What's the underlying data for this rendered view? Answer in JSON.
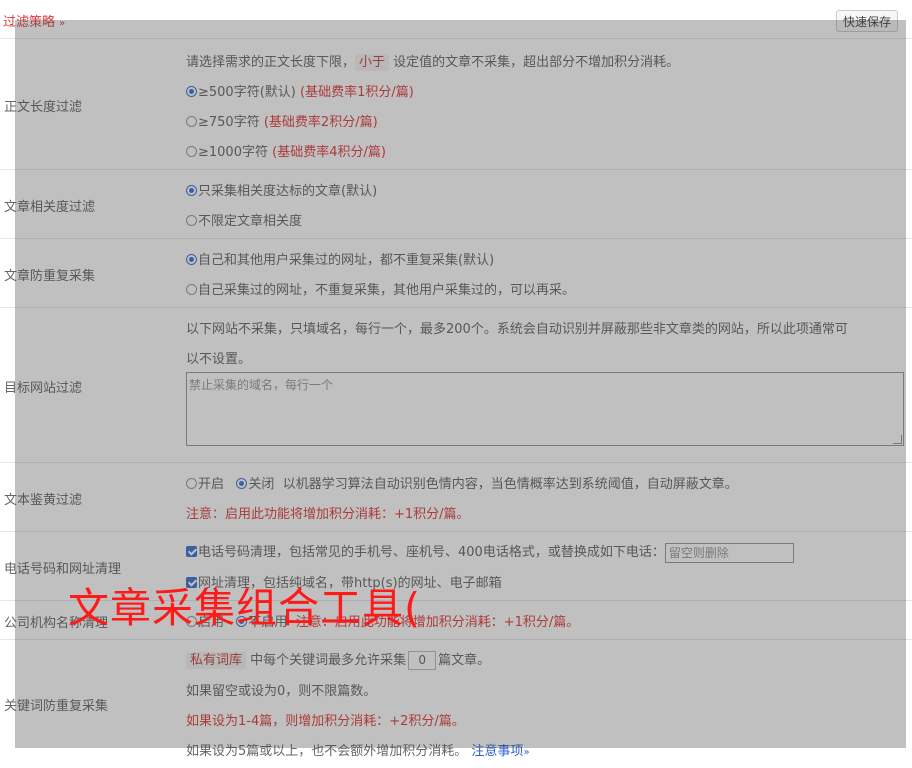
{
  "header": {
    "title": "过滤策略",
    "chevron": "»",
    "save_button": "快速保存"
  },
  "sections": {
    "length": {
      "label": "正文长度过滤",
      "intro_prefix": "请选择需求的正文长度下限，",
      "intro_tag": "小于",
      "intro_suffix": "设定值的文章不采集，超出部分不增加积分消耗。",
      "options": [
        {
          "text": "≥500字符(默认)",
          "note": "(基础费率1积分/篇)",
          "selected": true
        },
        {
          "text": "≥750字符",
          "note": "(基础费率2积分/篇)",
          "selected": false
        },
        {
          "text": "≥1000字符",
          "note": "(基础费率4积分/篇)",
          "selected": false
        }
      ]
    },
    "relevance": {
      "label": "文章相关度过滤",
      "options": [
        {
          "text": "只采集相关度达标的文章(默认)",
          "selected": true
        },
        {
          "text": "不限定文章相关度",
          "selected": false
        }
      ]
    },
    "dedupe": {
      "label": "文章防重复采集",
      "options": [
        {
          "text": "自己和其他用户采集过的网址，都不重复采集(默认)",
          "selected": true
        },
        {
          "text": "自己采集过的网址，不重复采集，其他用户采集过的，可以再采。",
          "selected": false
        }
      ]
    },
    "sites": {
      "label": "目标网站过滤",
      "intro_line1": "以下网站不采集，只填域名，每行一个，最多200个。系统会自动识别并屏蔽那些非文章类的网站，所以此项通常可",
      "intro_line2": "以不设置。",
      "placeholder": "禁止采集的域名，每行一个"
    },
    "porn": {
      "label": "文本鉴黄过滤",
      "option_on": "开启",
      "option_off": "关闭",
      "description": "以机器学习算法自动识别色情内容，当色情概率达到系统阈值，自动屏蔽文章。",
      "note": "注意：启用此功能将增加积分消耗：+1积分/篇。",
      "selected": "off"
    },
    "cleanup": {
      "label": "电话号码和网址清理",
      "phone_text": "电话号码清理，包括常见的手机号、座机号、400电话格式，或替换成如下电话：",
      "phone_placeholder": "留空则删除",
      "url_text": "网址清理，包括纯域名，带http(s)的网址、电子邮箱"
    },
    "company": {
      "label": "公司机构名称清理",
      "option_on": "启用",
      "option_off": "不启用",
      "note": "注意：启用此功能将增加积分消耗：+1积分/篇。",
      "selected": "off"
    },
    "keyword": {
      "label": "关键词防重复采集",
      "tag": "私有词库",
      "text_prefix": "中每个关键词最多允许采集",
      "value": "0",
      "text_suffix": "篇文章。",
      "line2": "如果留空或设为0，则不限篇数。",
      "line3": "如果设为1-4篇，则增加积分消耗：+2积分/篇。",
      "line4": "如果设为5篇或以上，也不会额外增加积分消耗。",
      "link": "注意事项",
      "link_chevron": "»"
    }
  },
  "watermark": "文章采集组合工具(",
  "colors": {
    "accent_red": "#e03b3b",
    "link_blue": "#2b5fcf",
    "radio_blue": "#3a72d6"
  }
}
